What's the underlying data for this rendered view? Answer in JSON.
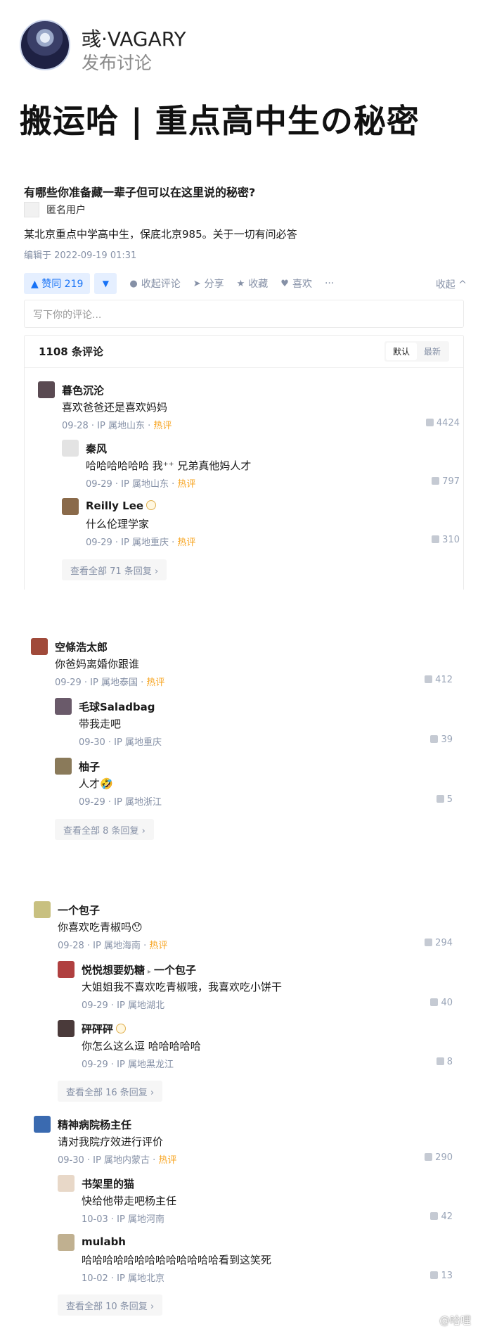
{
  "post": {
    "author_name": "彧·VAGARY",
    "author_sub": "发布讨论",
    "title": "搬运哈 | 重点高中生の秘密"
  },
  "question": {
    "title": "有哪些你准备藏一辈子但可以在这里说的秘密?",
    "author": "匿名用户",
    "body": "某北京重点中学高中生，保底北京985。关于一切有问必答",
    "edited": "编辑于 2022-09-19 01:31"
  },
  "actions": {
    "vote_up": "▲ 赞同 219",
    "vote_down": "▼",
    "collapse_comments": "收起评论",
    "share": "分享",
    "favorite": "收藏",
    "like": "喜欢",
    "more": "···",
    "collapse": "收起 ^"
  },
  "comment_input": {
    "placeholder": "写下你的评论..."
  },
  "comments_panel": {
    "count": "1108 条评论",
    "sort_default": "默认",
    "sort_latest": "最新"
  },
  "threads": [
    {
      "name": "暮色沉沦",
      "text": "喜欢爸爸还是喜欢妈妈",
      "meta": "09-28 · IP 属地山东 · ",
      "hot": "热评",
      "likes": "4424",
      "replies": [
        {
          "name": "秦风",
          "text": "哈哈哈哈哈哈 我⁺⁺ 兄弟真他妈人才",
          "meta": "09-29 · IP 属地山东 · ",
          "hot": "热评",
          "likes": "797"
        },
        {
          "name": "Reilly Lee",
          "text": "什么伦理学家",
          "meta": "09-29 · IP 属地重庆 · ",
          "hot": "热评",
          "likes": "310"
        }
      ],
      "more": "查看全部 71 条回复 ›"
    },
    {
      "name": "空條浩太郎",
      "text": "你爸妈离婚你跟谁",
      "meta": "09-29 · IP 属地泰国 · ",
      "hot": "热评",
      "likes": "412",
      "replies": [
        {
          "name": "毛球Saladbag",
          "text": "带我走吧",
          "meta": "09-30 · IP 属地重庆",
          "hot": "",
          "likes": "39"
        },
        {
          "name": "柚子",
          "text": "人才🤣",
          "meta": "09-29 · IP 属地浙江",
          "hot": "",
          "likes": "5"
        }
      ],
      "more": "查看全部 8 条回复 ›"
    },
    {
      "name": "一个包子",
      "text": "你喜欢吃青椒吗😯",
      "meta": "09-28 · IP 属地海南 · ",
      "hot": "热评",
      "likes": "294",
      "replies": [
        {
          "name": "悦悦想要奶糖",
          "reply_to": "一个包子",
          "text": "大姐姐我不喜欢吃青椒哦，我喜欢吃小饼干",
          "meta": "09-29 · IP 属地湖北",
          "hot": "",
          "likes": "40"
        },
        {
          "name": "砰砰砰",
          "text": "你怎么这么逗 哈哈哈哈哈",
          "meta": "09-29 · IP 属地黑龙江",
          "hot": "",
          "likes": "8"
        }
      ],
      "more": "查看全部 16 条回复 ›"
    },
    {
      "name": "精神病院杨主任",
      "text": "请对我院疗效进行评价",
      "meta": "09-30 · IP 属地内蒙古 · ",
      "hot": "热评",
      "likes": "290",
      "replies": [
        {
          "name": "书架里的猫",
          "text": "快给他带走吧杨主任",
          "meta": "10-03 · IP 属地河南",
          "hot": "",
          "likes": "42"
        },
        {
          "name": "mulabh",
          "text": "哈哈哈哈哈哈哈哈哈哈哈哈哈看到这笑死",
          "meta": "10-02 · IP 属地北京",
          "hot": "",
          "likes": "13"
        }
      ],
      "more": "查看全部 10 条回复 ›"
    }
  ],
  "watermark": "@哈哩"
}
